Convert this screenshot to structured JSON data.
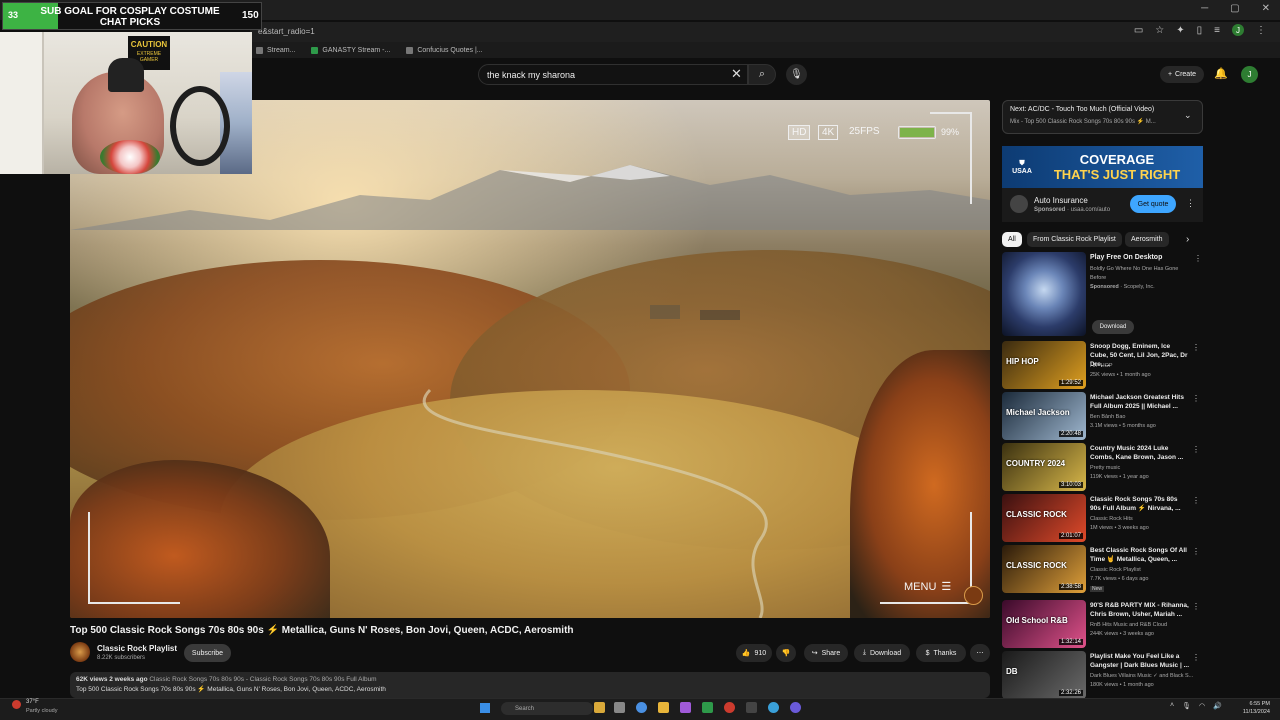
{
  "browser": {
    "url": "e&start_radio=1",
    "bookmarks": [
      "Stream...",
      "GANASTY Stream -...",
      "Confucius Quotes |..."
    ]
  },
  "overlay": {
    "goal_current": "33",
    "goal_title": "SUB GOAL FOR COSPLAY COSTUME CHAT PICKS",
    "goal_target": "150",
    "goal_progress": 0.22,
    "cam_sign_title": "CAUTION",
    "cam_sign_sub": "EXTREME GAMER"
  },
  "header": {
    "search_value": "the knack my sharona",
    "create_label": "Create",
    "profile_initial": "J"
  },
  "video": {
    "hud_hd": "HD",
    "hud_4k": "4K",
    "hud_fps": "25FPS",
    "hud_battery": "99%",
    "hud_battery_level": 0.99,
    "hud_menu": "MENU",
    "title": "Top 500 Classic Rock Songs 70s 80s 90s ⚡ Metallica, Guns N' Roses, Bon Jovi, Queen, ACDC, Aerosmith",
    "channel_name": "Classic Rock Playlist",
    "channel_subs": "8.22K subscribers",
    "subscribe": "Subscribe",
    "likes": "910",
    "share": "Share",
    "download": "Download",
    "thanks": "Thanks",
    "desc_views": "62K views  2 weeks ago",
    "desc_tags": "Classic Rock Songs 70s 80s 90s - Classic Rock Songs 70s 80s 90s Full Album",
    "desc_line2": "Top 500 Classic Rock Songs 70s 80s 90s ⚡ Metallica, Guns N' Roses, Bon Jovi, Queen, ACDC, Aerosmith"
  },
  "sidebar": {
    "next_label": "Next: AC/DC - Touch Too Much (Official Video)",
    "next_sub": "Mix - Top 500 Classic Rock Songs 70s 80s 90s ⚡ M...",
    "ad": {
      "logo": "USAA",
      "headline1": "COVERAGE",
      "headline2": "THAT'S JUST RIGHT",
      "title": "Auto Insurance",
      "sponsor_label": "Sponsored",
      "sponsor_url": "usaa.com/auto",
      "cta": "Get quote"
    },
    "chips": [
      "All",
      "From Classic Rock Playlist",
      "Aerosmith"
    ],
    "sponsored_rec": {
      "title": "Play Free On Desktop",
      "desc": "Boldly Go Where No One Has Gone Before",
      "by_label": "Sponsored",
      "by": "Scopely, Inc.",
      "cta": "Download"
    },
    "recs": [
      {
        "title": "Snoop Dogg, Eminem, Ice Cube, 50 Cent, Lil Jon, 2Pac, Dr Dre, ...",
        "channel": "HIP HOP",
        "meta": "25K views • 1 month ago",
        "duration": "1:29:52",
        "thumb_text": "HIP HOP",
        "color1": "#3a2a10",
        "color2": "#e0a020"
      },
      {
        "title": "Michael Jackson Greatest Hits Full Album 2025 || Michael ...",
        "channel": "Ben Bảnh Bao",
        "meta": "3.1M views • 5 months ago",
        "duration": "2:20:48",
        "thumb_text": "Michael Jackson",
        "color1": "#1b2a3a",
        "color2": "#9fb7cf"
      },
      {
        "title": "Country Music 2024 Luke Combs, Kane Brown, Jason ...",
        "channel": "Pretty music",
        "meta": "119K views • 1 year ago",
        "duration": "3:10:03",
        "thumb_text": "COUNTRY 2024",
        "color1": "#3a3010",
        "color2": "#d9b84a"
      },
      {
        "title": "Classic Rock Songs 70s 80s 90s Full Album ⚡ Nirvana, ...",
        "channel": "Classic Rock Hits",
        "meta": "1M views • 3 weeks ago",
        "duration": "2:01:07",
        "thumb_text": "CLASSIC ROCK",
        "color1": "#3a1010",
        "color2": "#e04a2a"
      },
      {
        "title": "Best Classic Rock Songs Of All Time 🤘 Metallica, Queen, ...",
        "channel": "Classic Rock Playlist",
        "meta": "7.7K views • 6 days ago",
        "duration": "2:38:58",
        "thumb_text": "CLASSIC ROCK",
        "color1": "#2a1a0a",
        "color2": "#e0a03a",
        "badge": "New"
      },
      {
        "title": "90'S R&B PARTY MIX - Rihanna, Chris Brown, Usher, Mariah ...",
        "channel": "RnB Hits Music and R&B Cloud",
        "meta": "244K views • 3 weeks ago",
        "duration": "1:32:14",
        "thumb_text": "Old School R&B",
        "color1": "#3a0a2a",
        "color2": "#e0528a"
      },
      {
        "title": "Playlist Make You Feel Like a Gangster | Dark Blues Music | ...",
        "channel": "Dark Blues Villains Music ✓ and Black S...",
        "meta": "180K views • 1 month ago",
        "duration": "2:32:26",
        "thumb_text": "DB",
        "color1": "#1a1a1a",
        "color2": "#6a6a6a"
      }
    ]
  },
  "taskbar": {
    "weather_temp": "37°F",
    "weather_desc": "Partly cloudy",
    "search": "Search",
    "time": "6:55 PM",
    "date": "11/13/2024"
  }
}
